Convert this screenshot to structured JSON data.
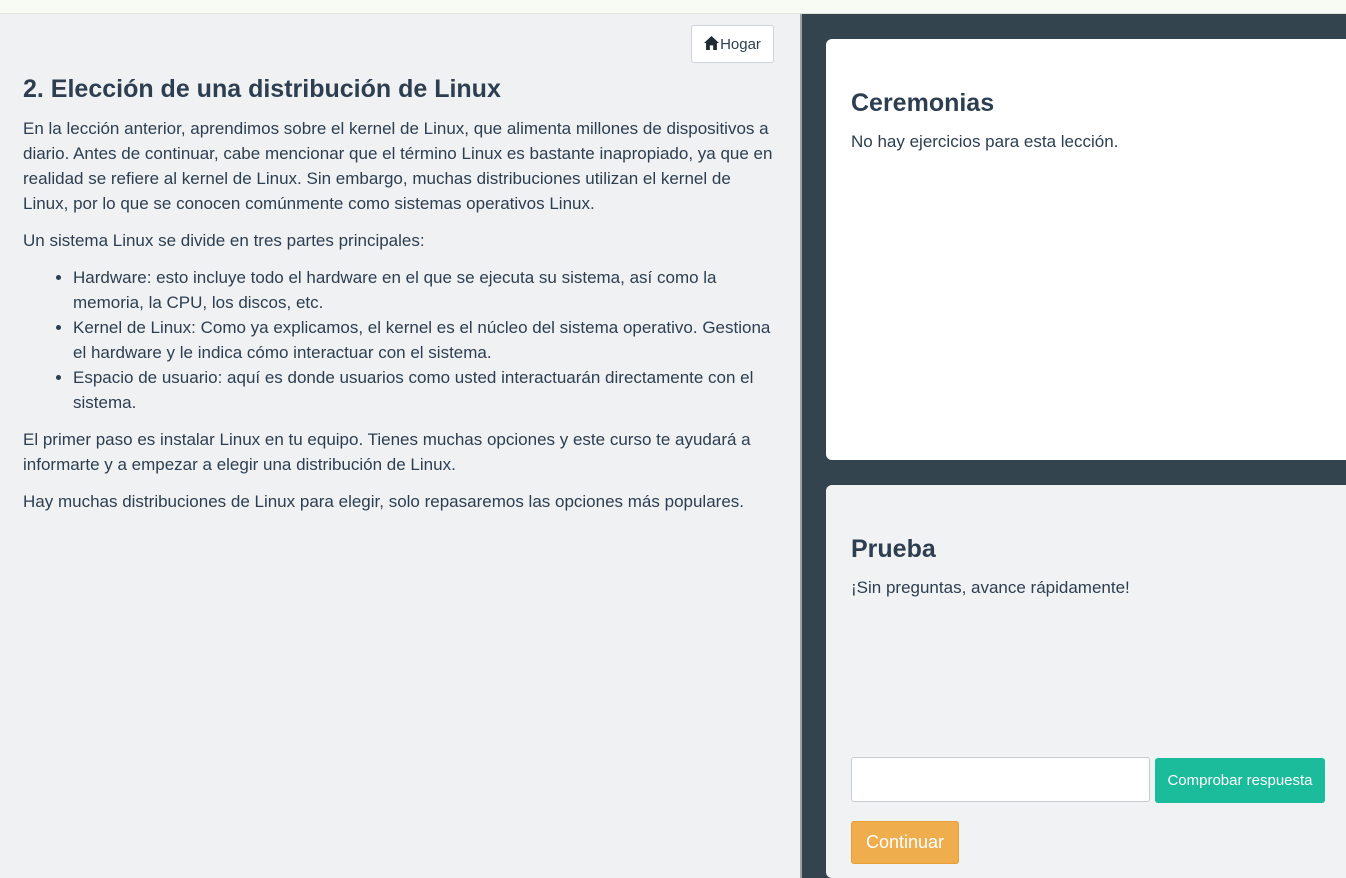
{
  "header": {
    "home_label": "Hogar"
  },
  "lesson": {
    "title": "2. Elección de una distribución de Linux",
    "paragraphs": [
      "En la lección anterior, aprendimos sobre el kernel de Linux, que alimenta millones de dispositivos a diario. Antes de continuar, cabe mencionar que el término Linux es bastante inapropiado, ya que en realidad se refiere al kernel de Linux. Sin embargo, muchas distribuciones utilizan el kernel de Linux, por lo que se conocen comúnmente como sistemas operativos Linux.",
      "Un sistema Linux se divide en tres partes principales:",
      "El primer paso es instalar Linux en tu equipo. Tienes muchas opciones y este curso te ayudará a informarte y a empezar a elegir una distribución de Linux.",
      "Hay muchas distribuciones de Linux para elegir, solo repasaremos las opciones más populares."
    ],
    "list_items": [
      "Hardware: esto incluye todo el hardware en el que se ejecuta su sistema, así como la memoria, la CPU, los discos, etc.",
      "Kernel de Linux: Como ya explicamos, el kernel es el núcleo del sistema operativo. Gestiona el hardware y le indica cómo interactuar con el sistema.",
      "Espacio de usuario: aquí es donde usuarios como usted interactuarán directamente con el sistema."
    ]
  },
  "exercises": {
    "title": "Ceremonias",
    "message": "No hay ejercicios para esta lección."
  },
  "quiz": {
    "title": "Prueba",
    "message": "¡Sin preguntas, avance rápidamente!",
    "answer_value": "",
    "check_label": "Comprobar respuesta",
    "continue_label": "Continuar"
  },
  "colors": {
    "sidebar_bg": "#34444f",
    "check_button": "#1abc9c",
    "continue_button": "#f0ad4e",
    "text": "#2c3e50"
  },
  "icons": {
    "home": "home-icon"
  }
}
